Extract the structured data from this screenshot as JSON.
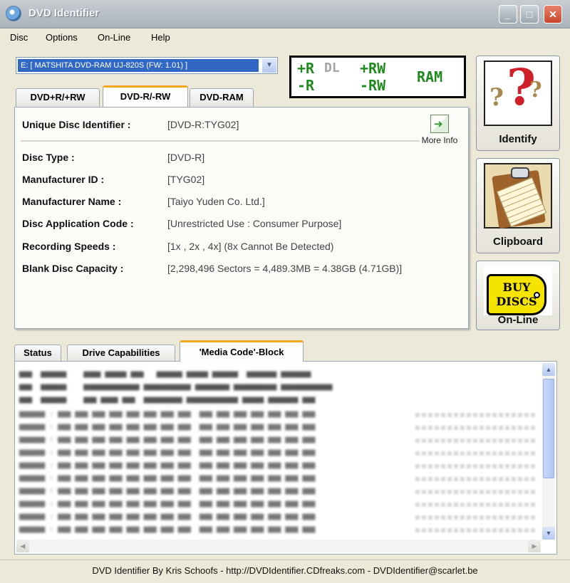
{
  "window": {
    "title": "DVD Identifier",
    "minimize_icon": "minimize-icon",
    "maximize_icon": "maximize-icon",
    "close_icon": "close-icon"
  },
  "menu": [
    "Disc",
    "Options",
    "On-Line",
    "Help"
  ],
  "drive": {
    "selected": "E: [ MATSHITA DVD-RAM UJ-820S (FW: 1.01) ]"
  },
  "formats": {
    "plus_r": "+R",
    "dl": "DL",
    "plus_rw": "+RW",
    "ram": "RAM",
    "minus_r": "-R",
    "minus_rw": "-RW",
    "active_color": "#1f8a1f",
    "inactive_color": "#a5a5a5"
  },
  "format_tabs": [
    {
      "label": "DVD+R/+RW",
      "active": false
    },
    {
      "label": "DVD-R/-RW",
      "active": true
    },
    {
      "label": "DVD-RAM",
      "active": false
    }
  ],
  "disc_info": {
    "uid_label": "Unique Disc Identifier :",
    "uid_value": "[DVD-R:TYG02]",
    "more_info": "More Info",
    "rows": [
      {
        "label": "Disc Type :",
        "value": "[DVD-R]"
      },
      {
        "label": "Manufacturer ID :",
        "value": "[TYG02]"
      },
      {
        "label": "Manufacturer Name :",
        "value": "[Taiyo Yuden Co. Ltd.]"
      },
      {
        "label": "Disc Application Code :",
        "value": "[Unrestricted Use : Consumer Purpose]"
      },
      {
        "label": "Recording Speeds :",
        "value": "[1x , 2x , 4x] (8x Cannot Be Detected)"
      },
      {
        "label": "Blank Disc Capacity :",
        "value": "[2,298,496 Sectors = 4,489.3MB = 4.38GB (4.71GB)]"
      }
    ]
  },
  "side_buttons": {
    "identify": "Identify",
    "clipboard": "Clipboard",
    "online": "On-Line",
    "buy_line1": "BUY",
    "buy_line2": "DISCS"
  },
  "bottom_tabs": [
    {
      "label": "Status",
      "active": false
    },
    {
      "label": "Drive Capabilities",
      "active": false
    },
    {
      "label": "'Media Code'-Block",
      "active": true
    }
  ],
  "statusbar": {
    "text": "DVD Identifier By Kris Schoofs  -  http://DVDIdentifier.CDfreaks.com  -  DVDIdentifier@scarlet.be"
  }
}
